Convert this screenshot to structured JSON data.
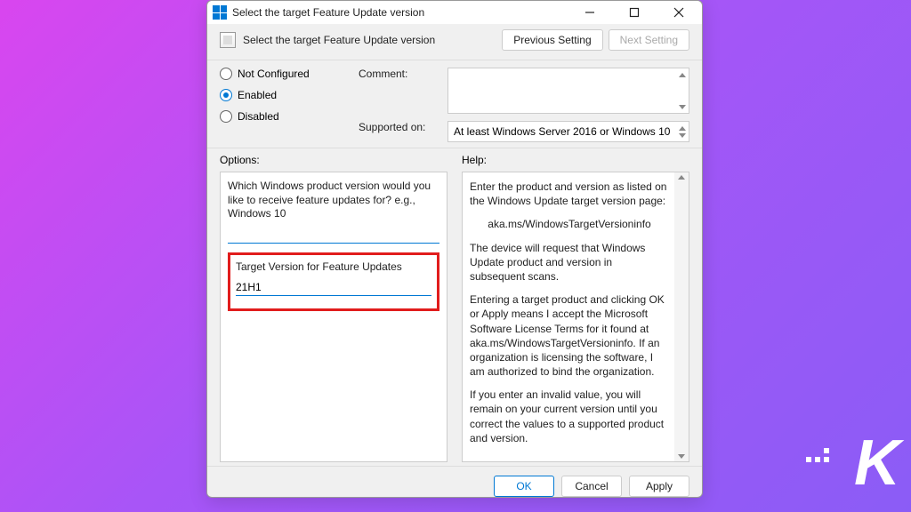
{
  "window": {
    "title": "Select the target Feature Update version"
  },
  "header": {
    "title": "Select the target Feature Update version",
    "previous_label": "Previous Setting",
    "next_label": "Next Setting"
  },
  "state": {
    "not_configured": "Not Configured",
    "enabled": "Enabled",
    "disabled": "Disabled",
    "selected": "enabled"
  },
  "meta": {
    "comment_label": "Comment:",
    "comment_value": "",
    "supported_label": "Supported on:",
    "supported_value": "At least Windows Server 2016 or Windows 10"
  },
  "options": {
    "header": "Options:",
    "product_prompt": "Which Windows product version would you like to receive feature updates for? e.g., Windows 10",
    "product_value": "",
    "target_label": "Target Version for Feature Updates",
    "target_value": "21H1"
  },
  "help": {
    "header": "Help:",
    "p1": "Enter the product and version as listed on the Windows Update target version page:",
    "p2": "aka.ms/WindowsTargetVersioninfo",
    "p3": "The device will request that Windows Update product and version in subsequent scans.",
    "p4": "Entering a target product and clicking OK or Apply means I accept the Microsoft Software License Terms for it found at aka.ms/WindowsTargetVersioninfo. If an organization is licensing the software, I am authorized to bind the organization.",
    "p5": "If you enter an invalid value, you will remain on your current version until you correct the values to a supported product and version."
  },
  "footer": {
    "ok": "OK",
    "cancel": "Cancel",
    "apply": "Apply"
  }
}
